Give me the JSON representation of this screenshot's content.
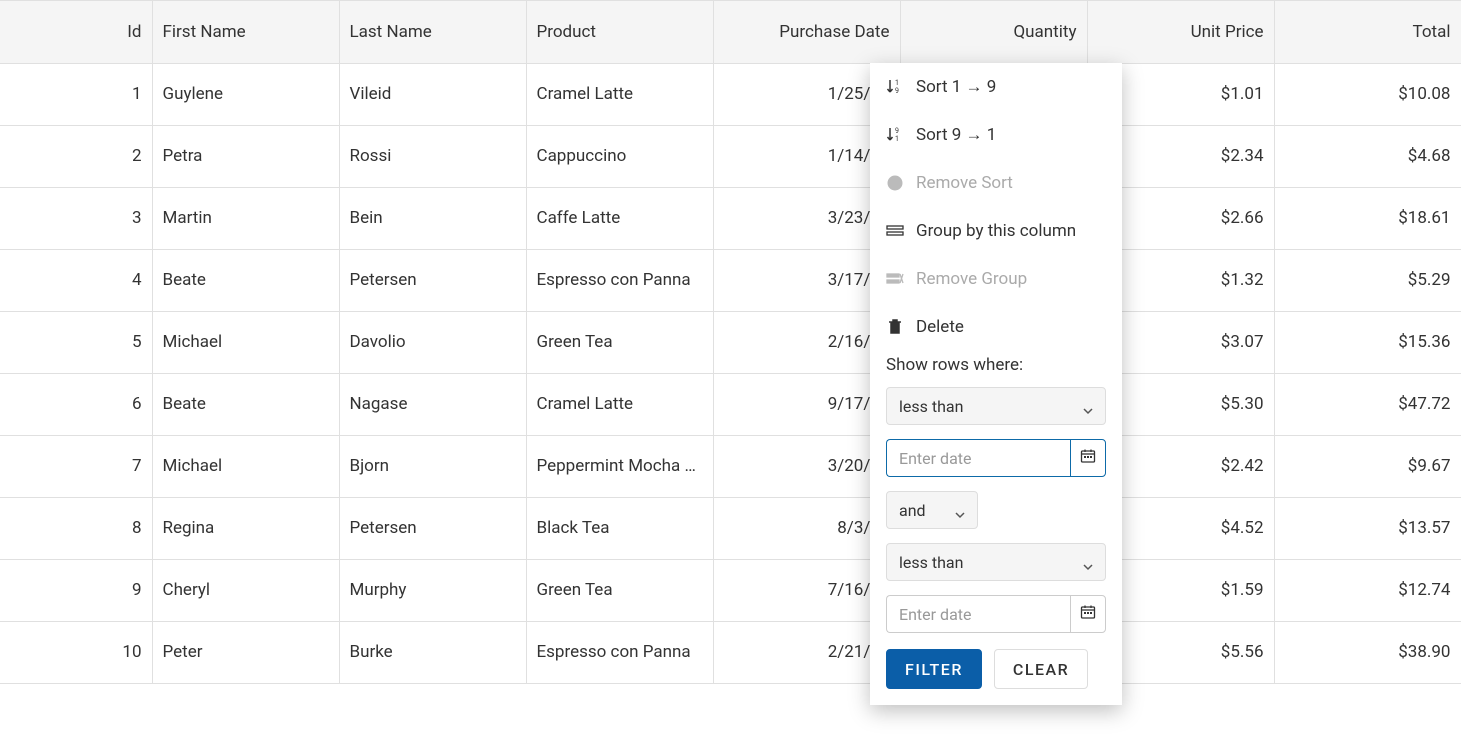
{
  "columns": {
    "id": "Id",
    "first": "First Name",
    "last": "Last Name",
    "product": "Product",
    "pdate": "Purchase Date",
    "qty": "Quantity",
    "uprice": "Unit Price",
    "total": "Total"
  },
  "rows": [
    {
      "id": "1",
      "first": "Guylene",
      "last": "Vileid",
      "product": "Cramel Latte",
      "pdate": "1/25/20",
      "uprice": "$1.01",
      "total": "$10.08"
    },
    {
      "id": "2",
      "first": "Petra",
      "last": "Rossi",
      "product": "Cappuccino",
      "pdate": "1/14/20",
      "uprice": "$2.34",
      "total": "$4.68"
    },
    {
      "id": "3",
      "first": "Martin",
      "last": "Bein",
      "product": "Caffe Latte",
      "pdate": "3/23/20",
      "uprice": "$2.66",
      "total": "$18.61"
    },
    {
      "id": "4",
      "first": "Beate",
      "last": "Petersen",
      "product": "Espresso con Panna",
      "pdate": "3/17/20",
      "uprice": "$1.32",
      "total": "$5.29"
    },
    {
      "id": "5",
      "first": "Michael",
      "last": "Davolio",
      "product": "Green Tea",
      "pdate": "2/16/20",
      "uprice": "$3.07",
      "total": "$15.36"
    },
    {
      "id": "6",
      "first": "Beate",
      "last": "Nagase",
      "product": "Cramel Latte",
      "pdate": "9/17/20",
      "uprice": "$5.30",
      "total": "$47.72"
    },
    {
      "id": "7",
      "first": "Michael",
      "last": "Bjorn",
      "product": "Peppermint Mocha …",
      "pdate": "3/20/20",
      "uprice": "$2.42",
      "total": "$9.67"
    },
    {
      "id": "8",
      "first": "Regina",
      "last": "Petersen",
      "product": "Black Tea",
      "pdate": "8/3/20",
      "uprice": "$4.52",
      "total": "$13.57"
    },
    {
      "id": "9",
      "first": "Cheryl",
      "last": "Murphy",
      "product": "Green Tea",
      "pdate": "7/16/20",
      "uprice": "$1.59",
      "total": "$12.74"
    },
    {
      "id": "10",
      "first": "Peter",
      "last": "Burke",
      "product": "Espresso con Panna",
      "pdate": "2/21/20",
      "uprice": "$5.56",
      "total": "$38.90"
    }
  ],
  "menu": {
    "sort_asc": "Sort 1 → 9",
    "sort_desc": "Sort 9 → 1",
    "remove_sort": "Remove Sort",
    "group_by": "Group by this column",
    "remove_group": "Remove Group",
    "delete": "Delete",
    "show_rows": "Show rows where:",
    "op1": "less than",
    "date1_placeholder": "Enter date",
    "logic": "and",
    "op2": "less than",
    "date2_placeholder": "Enter date",
    "filter_btn": "FILTER",
    "clear_btn": "CLEAR"
  }
}
